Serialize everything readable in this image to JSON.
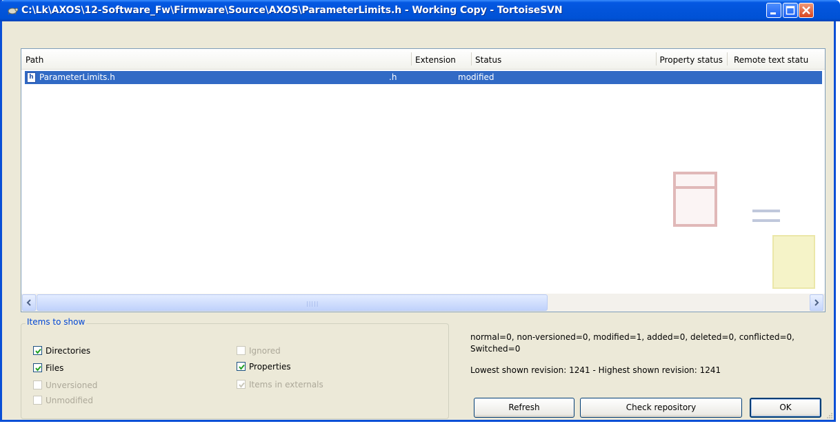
{
  "window": {
    "title": "C:\\Lk\\AXOS\\12-Software_Fw\\Firmware\\Source\\AXOS\\ParameterLimits.h - Working Copy - TortoiseSVN"
  },
  "list": {
    "columns": [
      "Path",
      "Extension",
      "Status",
      "Property status",
      "Remote text statu"
    ],
    "rows": [
      {
        "path": "ParameterLimits.h",
        "extension": ".h",
        "status": "modified",
        "icon": "h-file-icon"
      }
    ]
  },
  "items_to_show": {
    "label": "Items to show",
    "checkboxes": [
      {
        "label": "Directories",
        "checked": true,
        "enabled": true
      },
      {
        "label": "Files",
        "checked": true,
        "enabled": true
      },
      {
        "label": "Unversioned",
        "checked": false,
        "enabled": false
      },
      {
        "label": "Unmodified",
        "checked": false,
        "enabled": false
      },
      {
        "label": "Ignored",
        "checked": false,
        "enabled": false
      },
      {
        "label": "Properties",
        "checked": true,
        "enabled": true
      },
      {
        "label": "Items in externals",
        "checked": true,
        "enabled": false
      }
    ]
  },
  "summary": {
    "counts": "normal=0, non-versioned=0, modified=1, added=0, deleted=0, conflicted=0, Switched=0",
    "revisions": "Lowest shown revision: 1241 - Highest shown revision: 1241"
  },
  "buttons": {
    "refresh": "Refresh",
    "check_repository": "Check repository",
    "ok": "OK"
  },
  "colors": {
    "selection": "#316ac5",
    "titlebar": "#0254da",
    "dialog_bg": "#ece9d8",
    "group_label": "#0046d5"
  }
}
